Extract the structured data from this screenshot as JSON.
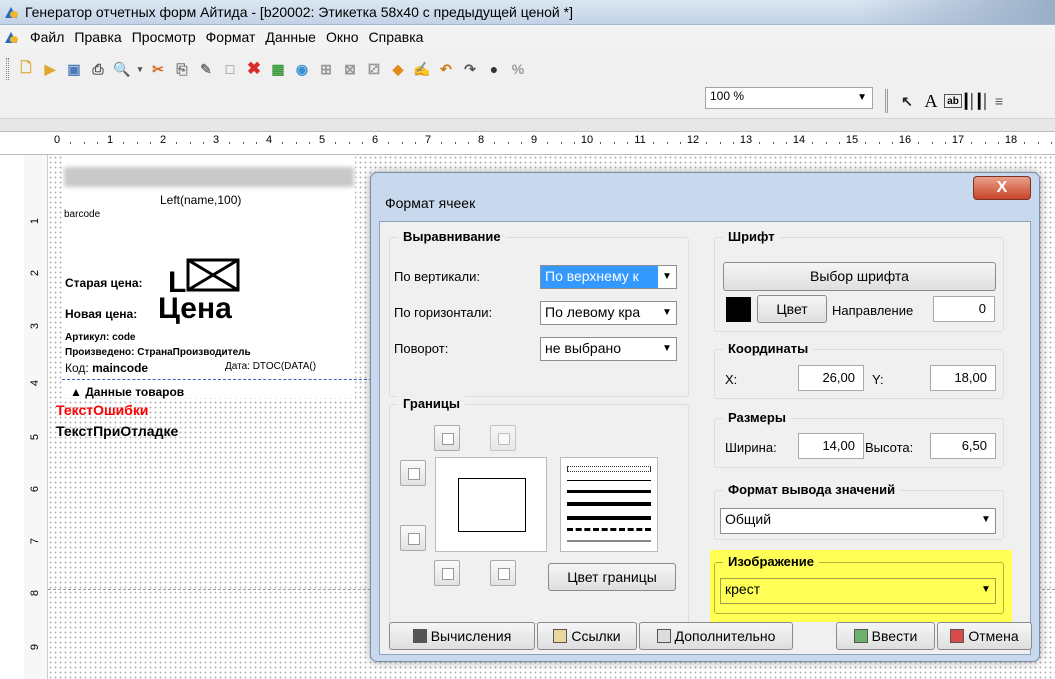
{
  "window": {
    "title": "Генератор отчетных форм Айтида - [b20002: Этикетка 58x40 с предыдущей ценой *]"
  },
  "menu": [
    "Файл",
    "Правка",
    "Просмотр",
    "Формат",
    "Данные",
    "Окно",
    "Справка"
  ],
  "toolbar": {
    "zoom": "100 %"
  },
  "ruler": [
    "0",
    "1",
    "2",
    "3",
    "4",
    "5",
    "6",
    "7",
    "8",
    "9",
    "10",
    "11",
    "12",
    "13",
    "14",
    "15",
    "16",
    "17",
    "18"
  ],
  "design": {
    "name_field": "Left(name,100)",
    "barcode": "barcode",
    "old_price": "Старая цена:",
    "new_price": "Новая цена:",
    "price_value": "Цена",
    "article": "Артикул:",
    "article_value": "code",
    "produced": "Произведено:",
    "produced_value": "СтранаПроизводитель",
    "code": "Код:",
    "code_value": "maincode",
    "date": "Дата:",
    "date_value": "DTOC(DATA()",
    "band_title": "Данные товаров",
    "error_text": "ТекстОшибки",
    "debug_text": "ТекстПриОтладке"
  },
  "dialog": {
    "title": "Формат ячеек",
    "close": "X",
    "alignment": {
      "title": "Выравнивание",
      "vertical_label": "По вертикали:",
      "vertical_value": "По верхнему к",
      "horizontal_label": "По горизонтали:",
      "horizontal_value": "По левому кра",
      "rotation_label": "Поворот:",
      "rotation_value": "не выбрано"
    },
    "borders": {
      "title": "Границы",
      "color_button": "Цвет границы"
    },
    "font": {
      "title": "Шрифт",
      "choose_button": "Выбор шрифта",
      "color_button": "Цвет",
      "direction_label": "Направление",
      "direction_value": "0"
    },
    "coords": {
      "title": "Координаты",
      "x_label": "X:",
      "x_value": "26,00",
      "y_label": "Y:",
      "y_value": "18,00"
    },
    "sizes": {
      "title": "Размеры",
      "width_label": "Ширина:",
      "width_value": "14,00",
      "height_label": "Высота:",
      "height_value": "6,50"
    },
    "format": {
      "title": "Формат вывода значений",
      "value": "Общий"
    },
    "image": {
      "title": "Изображение",
      "value": "крест"
    },
    "buttons": {
      "calc": "Вычисления",
      "links": "Ссылки",
      "more": "Дополнительно",
      "ok": "Ввести",
      "cancel": "Отмена"
    }
  },
  "colors": {
    "highlight": "#ffff55",
    "selection": "#3399ff",
    "error_text": "#ff0000"
  }
}
